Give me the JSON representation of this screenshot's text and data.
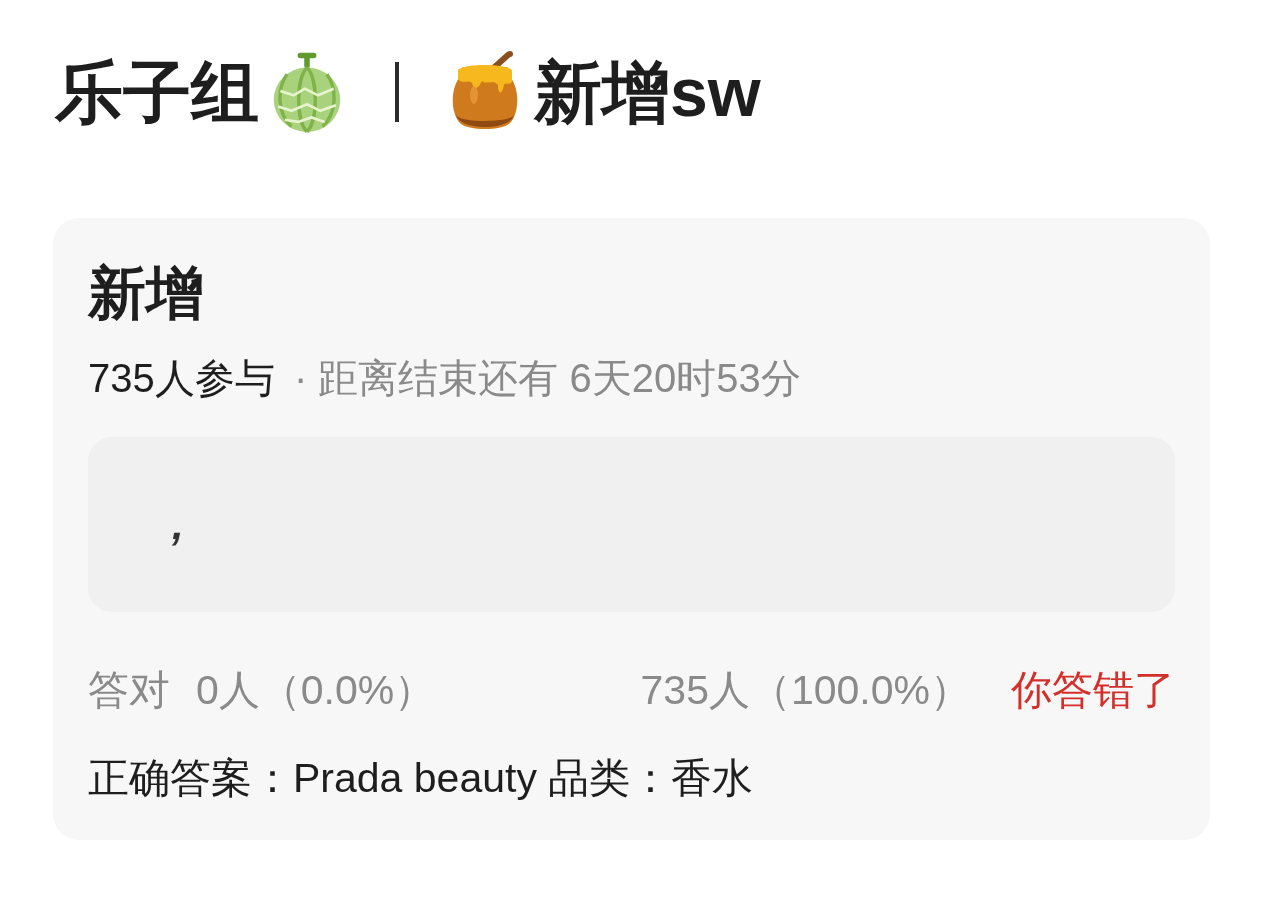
{
  "header": {
    "group_name": "乐子组",
    "quiz_name": "新增sw"
  },
  "card": {
    "title": "新增",
    "participants": "735人参与",
    "time_left": "· 距离结束还有 6天20时53分",
    "answer": {
      "value": ","
    },
    "stats": {
      "correct_label": "答对",
      "correct_count": "0人（0.0%）",
      "wrong_count": "735人（100.0%）",
      "result": "你答错了",
      "correct": false
    },
    "correct_answer": "正确答案：Prada beauty 品类：香水"
  }
}
